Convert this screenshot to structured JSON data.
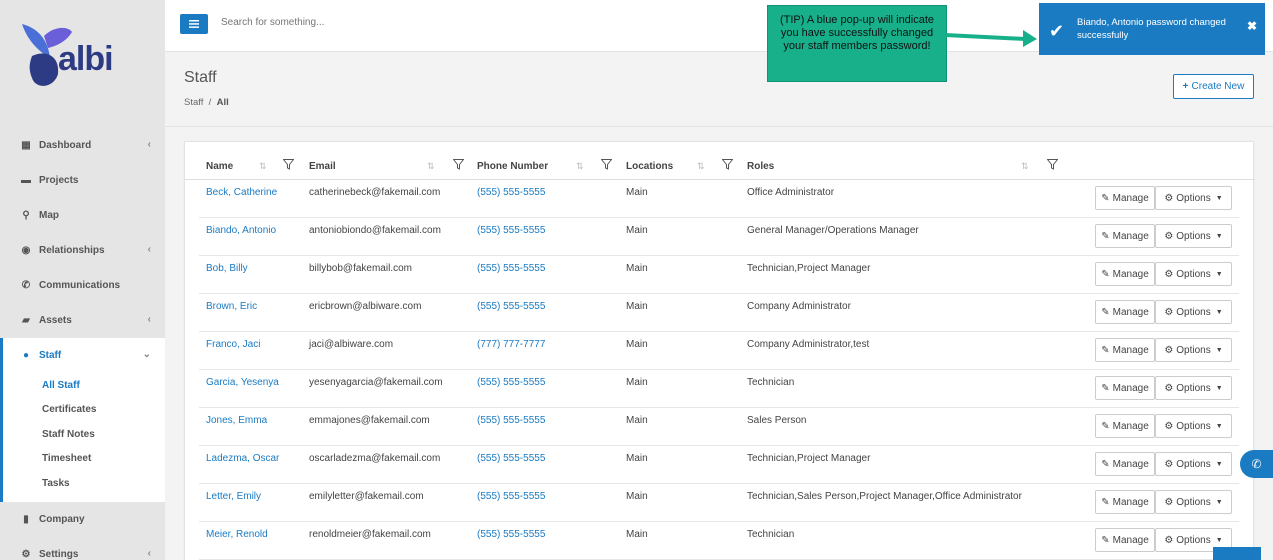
{
  "logo": {
    "text": "albi"
  },
  "search": {
    "placeholder": "Search for something..."
  },
  "nav": [
    {
      "label": "Dashboard",
      "icon": "dashboard-icon",
      "chevron": "‹"
    },
    {
      "label": "Projects",
      "icon": "briefcase-icon",
      "chevron": ""
    },
    {
      "label": "Map",
      "icon": "map-pin-icon",
      "chevron": ""
    },
    {
      "label": "Relationships",
      "icon": "eye-icon",
      "chevron": "‹"
    },
    {
      "label": "Communications",
      "icon": "phone-icon",
      "chevron": ""
    },
    {
      "label": "Assets",
      "icon": "truck-icon",
      "chevron": "‹"
    },
    {
      "label": "Staff",
      "icon": "users-icon",
      "chevron": "⌄"
    }
  ],
  "subnav": [
    "All Staff",
    "Certificates",
    "Staff Notes",
    "Timesheet",
    "Tasks"
  ],
  "nav_after": [
    {
      "label": "Company",
      "icon": "building-icon",
      "chevron": ""
    },
    {
      "label": "Settings",
      "icon": "gears-icon",
      "chevron": "‹"
    }
  ],
  "page": {
    "title": "Staff",
    "crumb_root": "Staff",
    "crumb_sep": "/",
    "crumb_current": "All",
    "create_label": "Create New"
  },
  "table": {
    "headers": [
      "Name",
      "Email",
      "Phone Number",
      "Locations",
      "Roles"
    ],
    "manage_label": "Manage",
    "options_label": "Options",
    "rows": [
      [
        "Beck, Catherine",
        "catherinebeck@fakemail.com",
        "(555) 555-5555",
        "Main",
        "Office Administrator"
      ],
      [
        "Biando, Antonio",
        "antoniobiondo@fakemail.com",
        "(555) 555-5555",
        "Main",
        "General Manager/Operations Manager"
      ],
      [
        "Bob, Billy",
        "billybob@fakemail.com",
        "(555) 555-5555",
        "Main",
        "Technician,Project Manager"
      ],
      [
        "Brown, Eric",
        "ericbrown@albiware.com",
        "(555) 555-5555",
        "Main",
        "Company Administrator"
      ],
      [
        "Franco, Jaci",
        "jaci@albiware.com",
        "(777) 777-7777",
        "Main",
        "Company Administrator,test"
      ],
      [
        "Garcia, Yesenya",
        "yesenyagarcia@fakemail.com",
        "(555) 555-5555",
        "Main",
        "Technician"
      ],
      [
        "Jones, Emma",
        "emmajones@fakemail.com",
        "(555) 555-5555",
        "Main",
        "Sales Person"
      ],
      [
        "Ladezma, Oscar",
        "oscarladezma@fakemail.com",
        "(555) 555-5555",
        "Main",
        "Technician,Project Manager"
      ],
      [
        "Letter, Emily",
        "emilyletter@fakemail.com",
        "(555) 555-5555",
        "Main",
        "Technician,Sales Person,Project Manager,Office Administrator"
      ],
      [
        "Meier, Renold",
        "renoldmeier@fakemail.com",
        "(555) 555-5555",
        "Main",
        "Technician"
      ]
    ]
  },
  "toast": {
    "message": "Biando, Antonio password changed successfully",
    "close": "✖"
  },
  "tip": {
    "text": "(TIP) A blue pop-up will indicate you have successfully changed your staff members password!"
  },
  "colors": {
    "accent": "#1a7bc3",
    "tip": "#17b08a",
    "sidebar": "#e5e5e5"
  }
}
